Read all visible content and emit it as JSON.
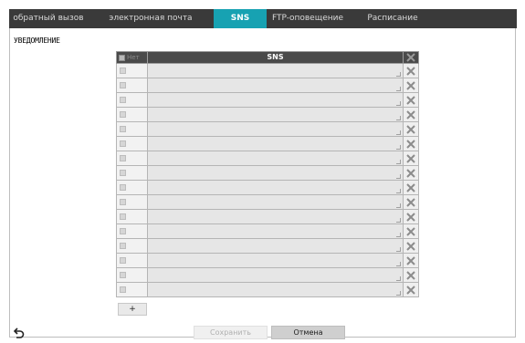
{
  "tabs": [
    {
      "label": "обратный вызов",
      "active": false
    },
    {
      "label": "электронная почта",
      "active": false
    },
    {
      "label": "SNS",
      "active": true
    },
    {
      "label": "FTP-оповещение",
      "active": false
    },
    {
      "label": "Расписание",
      "active": false
    }
  ],
  "section_title": "УВЕДОМЛЕНИЕ",
  "grid": {
    "header_none": "Нет",
    "header_sns": "SNS",
    "row_count": 16
  },
  "buttons": {
    "add": "+",
    "save": "Сохранить",
    "cancel": "Отмена"
  },
  "icons": {
    "back": "back-arrow-icon",
    "delete": "close-icon"
  },
  "colors": {
    "tab_bar": "#3a3a3a",
    "tab_active": "#17a2b2",
    "grid_header": "#4a4a4a"
  }
}
